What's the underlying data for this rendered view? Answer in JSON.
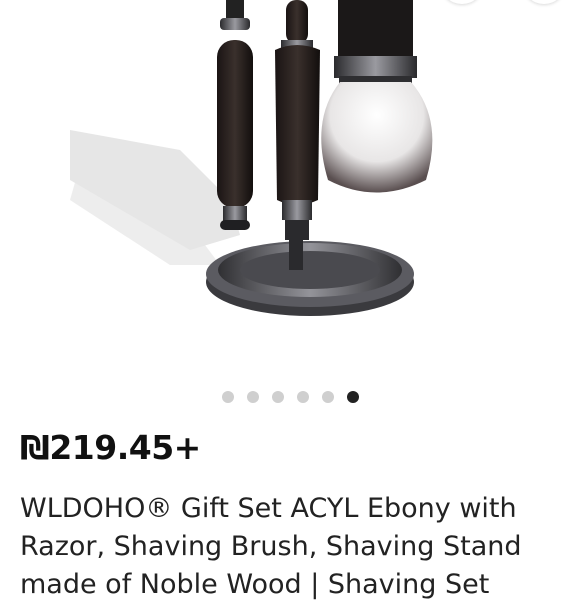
{
  "product": {
    "price": "₪219.45+",
    "title": "WLDOHO® Gift Set ACYL Ebony with Razor, Shaving Brush, Shaving Stand made of Noble Wood | Shaving Set"
  },
  "carousel": {
    "count": 6,
    "active_index": 5
  },
  "icons": {
    "top_right_1": "share-icon",
    "top_right_2": "favorite-icon"
  }
}
